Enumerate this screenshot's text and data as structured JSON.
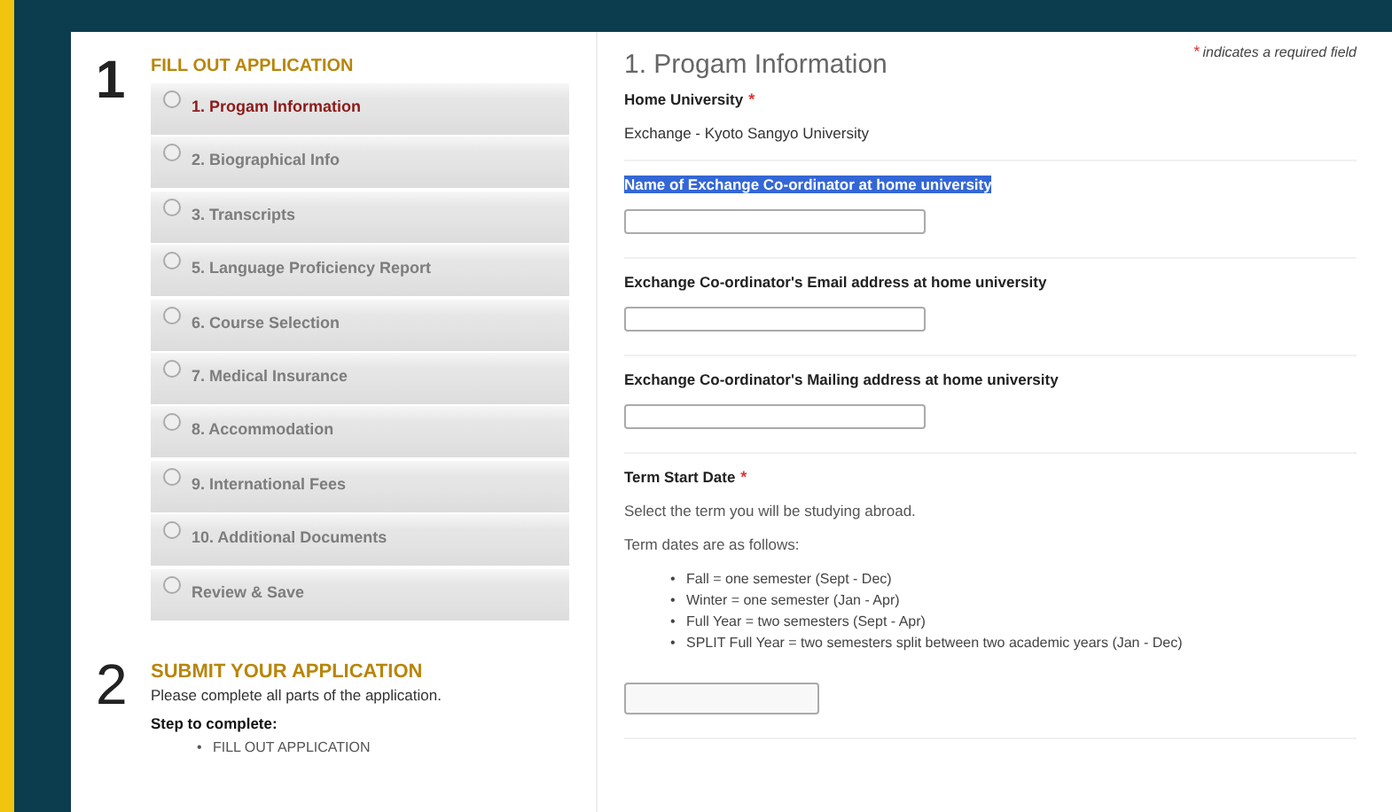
{
  "steps_section": {
    "number": "1",
    "heading": "FILL OUT APPLICATION",
    "steps": [
      {
        "label": "1. Progam Information",
        "selected": true
      },
      {
        "label": "2. Biographical Info",
        "selected": false
      },
      {
        "label": "3. Transcripts",
        "selected": false
      },
      {
        "label": "5. Language Proficiency Report",
        "selected": false
      },
      {
        "label": "6. Course Selection",
        "selected": false
      },
      {
        "label": "7. Medical Insurance",
        "selected": false
      },
      {
        "label": "8. Accommodation",
        "selected": false
      },
      {
        "label": "9. International Fees",
        "selected": false
      },
      {
        "label": "10. Additional Documents",
        "selected": false
      },
      {
        "label": "Review & Save",
        "selected": false
      }
    ]
  },
  "submit_section": {
    "number": "2",
    "heading": "SUBMIT YOUR APPLICATION",
    "text": "Please complete all parts of the application.",
    "steps_label": "Step to complete:",
    "items": [
      {
        "marker": "•",
        "text": "FILL OUT APPLICATION"
      }
    ]
  },
  "form": {
    "title": "1. Progam Information",
    "required_note": {
      "mark": "*",
      "text": "indicates a required field"
    },
    "fields": [
      {
        "kind": "static",
        "label": "Home University",
        "highlighted": false,
        "required_mark": "*",
        "value": "Exchange - Kyoto Sangyo University"
      },
      {
        "kind": "text",
        "label": "Name of Exchange Co-ordinator at home university",
        "highlighted": true
      },
      {
        "kind": "text",
        "label": "Exchange Co-ordinator's Email address at home university",
        "highlighted": false
      },
      {
        "kind": "text",
        "label": "Exchange Co-ordinator's Mailing address at home university",
        "highlighted": false
      },
      {
        "kind": "select",
        "label": "Term Start Date",
        "highlighted": false,
        "required_mark": "*",
        "paragraphs": [
          "Select the term you will be studying abroad.",
          "Term dates are as follows:"
        ],
        "bullets": [
          {
            "marker": "•",
            "text": "Fall = one semester (Sept - Dec)"
          },
          {
            "marker": "•",
            "text": "Winter = one semester (Jan - Apr)"
          },
          {
            "marker": "•",
            "text": "Full Year = two semesters (Sept - Apr)"
          },
          {
            "marker": "•",
            "text": "SPLIT Full Year = two semesters split between two academic years (Jan - Dec)"
          }
        ]
      }
    ]
  }
}
